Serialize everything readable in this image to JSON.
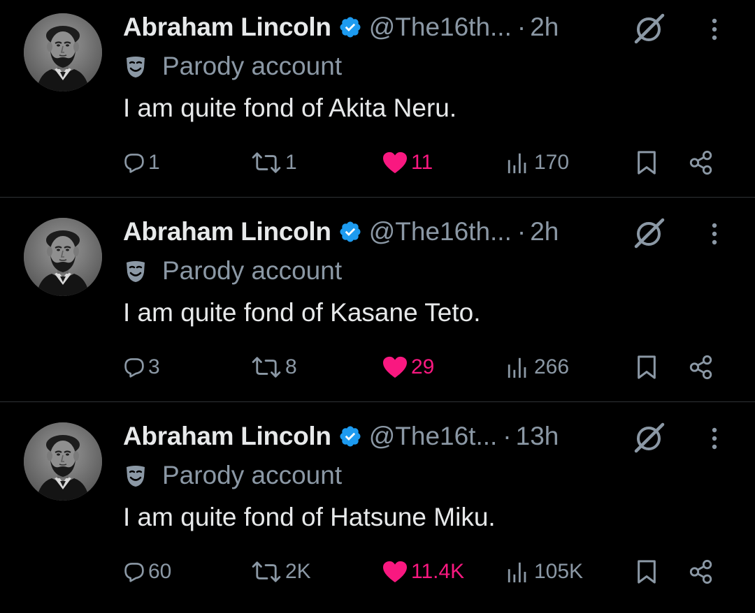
{
  "colors": {
    "background": "#000000",
    "text_primary": "#e7e9ea",
    "text_secondary": "#8b98a5",
    "like_active": "#f91880",
    "verified_badge": "#1d9bf0",
    "divider": "#2f3336"
  },
  "icons": {
    "verified": "verified-badge-icon",
    "grok": "grok-icon",
    "more": "more-vertical-icon",
    "parody": "theater-mask-icon",
    "reply": "reply-icon",
    "retweet": "retweet-icon",
    "like": "heart-filled-icon",
    "views": "views-chart-icon",
    "bookmark": "bookmark-icon",
    "share": "share-icon"
  },
  "tweets": [
    {
      "name": "Abraham Lincoln",
      "handle": "@The16th...",
      "separator": "·",
      "time": "2h",
      "label": "Parody account",
      "text": "I am quite fond of Akita Neru.",
      "replies": "1",
      "retweets": "1",
      "likes": "11",
      "views": "170",
      "liked": true
    },
    {
      "name": "Abraham Lincoln",
      "handle": "@The16th...",
      "separator": "·",
      "time": "2h",
      "label": "Parody account",
      "text": "I am quite fond of Kasane Teto.",
      "replies": "3",
      "retweets": "8",
      "likes": "29",
      "views": "266",
      "liked": true
    },
    {
      "name": "Abraham Lincoln",
      "handle": "@The16t...",
      "separator": "·",
      "time": "13h",
      "label": "Parody account",
      "text": "I am quite fond of Hatsune Miku.",
      "replies": "60",
      "retweets": "2K",
      "likes": "11.4K",
      "views": "105K",
      "liked": true
    }
  ]
}
